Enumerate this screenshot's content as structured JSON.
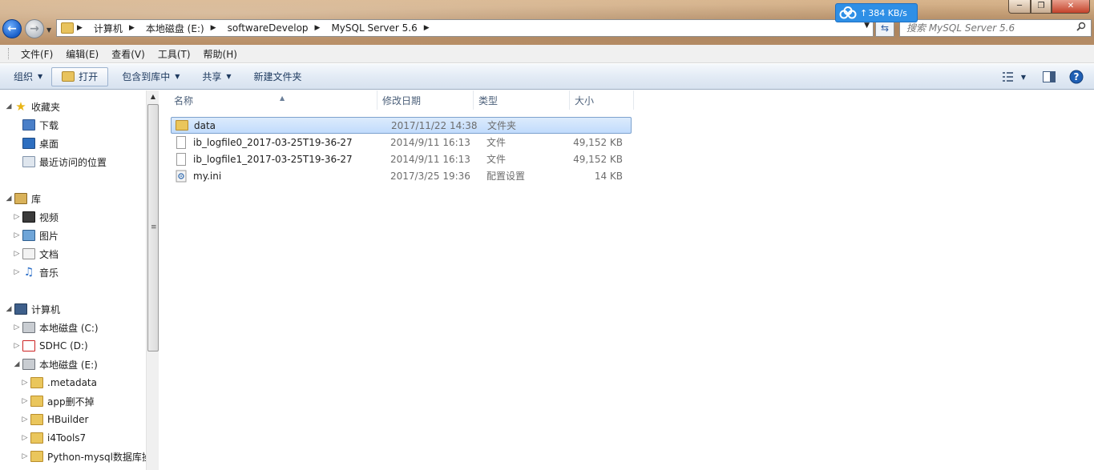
{
  "address": {
    "crumbs": [
      "计算机",
      "本地磁盘 (E:)",
      "softwareDevelop",
      "MySQL Server 5.6"
    ]
  },
  "search": {
    "placeholder": "搜索 MySQL Server 5.6"
  },
  "netspeed": {
    "value": "384 KB/s"
  },
  "menu": [
    "文件(F)",
    "编辑(E)",
    "查看(V)",
    "工具(T)",
    "帮助(H)"
  ],
  "toolbar": {
    "organize": "组织",
    "open": "打开",
    "include_library": "包含到库中",
    "share": "共享",
    "new_folder": "新建文件夹"
  },
  "nav": {
    "favorites": "收藏夹",
    "downloads": "下载",
    "desktop": "桌面",
    "recent": "最近访问的位置",
    "libraries": "库",
    "videos": "视频",
    "pictures": "图片",
    "documents": "文档",
    "music": "音乐",
    "computer": "计算机",
    "drive_c": "本地磁盘 (C:)",
    "drive_d": "SDHC (D:)",
    "drive_e": "本地磁盘 (E:)",
    "folders": [
      ".metadata",
      "app删不掉",
      "HBuilder",
      "i4Tools7",
      "Python-mysql数据库操"
    ]
  },
  "columns": {
    "name": "名称",
    "date": "修改日期",
    "type": "类型",
    "size": "大小"
  },
  "files": [
    {
      "name": "data",
      "date": "2017/11/22 14:38",
      "type": "文件夹",
      "size": "",
      "icon": "folder-icon"
    },
    {
      "name": "ib_logfile0_2017-03-25T19-36-27",
      "date": "2014/9/11 16:13",
      "type": "文件",
      "size": "49,152 KB",
      "icon": "file-icon"
    },
    {
      "name": "ib_logfile1_2017-03-25T19-36-27",
      "date": "2014/9/11 16:13",
      "type": "文件",
      "size": "49,152 KB",
      "icon": "file-icon"
    },
    {
      "name": "my.ini",
      "date": "2017/3/25 19:36",
      "type": "配置设置",
      "size": "14 KB",
      "icon": "settings-file-icon"
    }
  ]
}
